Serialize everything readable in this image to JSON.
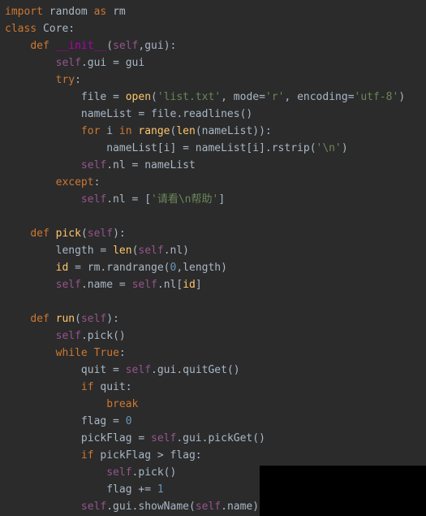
{
  "code": {
    "l1": {
      "kw1": "import",
      "id1": " random ",
      "kw2": "as",
      "id2": " rm"
    },
    "l2": {
      "kw": "class",
      "name": " Core",
      "colon": ":"
    },
    "l3": {
      "kw": "def",
      "sp": " ",
      "name": "__init__",
      "open": "(",
      "p1": "self",
      "comma": ",",
      "p2": "gui",
      "close": "):"
    },
    "l4": {
      "a": "self",
      "dot": ".",
      "b": "gui = gui"
    },
    "l5": {
      "kw": "try",
      "colon": ":"
    },
    "l6": {
      "a": "file = ",
      "fn": "open",
      "open": "(",
      "s1": "'list.txt'",
      "comma": ", ",
      "k1": "mode=",
      "s2": "'r'",
      "comma2": ", ",
      "k2": "encoding=",
      "s3": "'utf-8'",
      "close": ")"
    },
    "l7": {
      "a": "nameList = file.readlines()"
    },
    "l8": {
      "kw1": "for",
      "a": " i ",
      "kw2": "in",
      "b": " ",
      "fn": "range",
      "open": "(",
      "fn2": "len",
      "open2": "(nameList)):"
    },
    "l9": {
      "a": "nameList[i] = nameList[i].rstrip(",
      "s": "'\\n'",
      "b": ")"
    },
    "l10": {
      "a": "self",
      "b": ".nl = nameList"
    },
    "l11": {
      "kw": "except",
      "colon": ":"
    },
    "l12": {
      "a": "self",
      "b": ".nl = [",
      "s": "'请看\\n帮助'",
      "c": "]"
    },
    "l13": "",
    "l14": {
      "kw": "def",
      "sp": " ",
      "name": "pick",
      "open": "(",
      "p": "self",
      "close": "):"
    },
    "l15": {
      "a": "length = ",
      "fn": "len",
      "b": "(",
      "c": "self",
      "d": ".nl)"
    },
    "l16": {
      "a": "id",
      "b": " = rm.randrange(",
      "n": "0",
      "c": ",length)"
    },
    "l17": {
      "a": "self",
      "b": ".name = ",
      "c": "self",
      "d": ".nl[",
      "e": "id",
      "f": "]"
    },
    "l18": "",
    "l19": {
      "kw": "def",
      "sp": " ",
      "name": "run",
      "open": "(",
      "p": "self",
      "close": "):"
    },
    "l20": {
      "a": "self",
      "b": ".pick()"
    },
    "l21": {
      "kw": "while",
      "sp": " ",
      "v": "True",
      "colon": ":"
    },
    "l22": {
      "a": "quit = ",
      "b": "self",
      "c": ".gui.quitGet()"
    },
    "l23": {
      "kw": "if",
      "a": " quit:"
    },
    "l24": {
      "kw": "break"
    },
    "l25": {
      "a": "flag = ",
      "n": "0"
    },
    "l26": {
      "a": "pickFlag = ",
      "b": "self",
      "c": ".gui.pickGet()"
    },
    "l27": {
      "kw": "if",
      "a": " pickFlag > flag:"
    },
    "l28": {
      "a": "self",
      "b": ".pick()"
    },
    "l29": {
      "a": "flag += ",
      "n": "1"
    },
    "l30": {
      "a": "self",
      "b": ".gui.showName(",
      "c": "self",
      "d": ".name)"
    }
  }
}
